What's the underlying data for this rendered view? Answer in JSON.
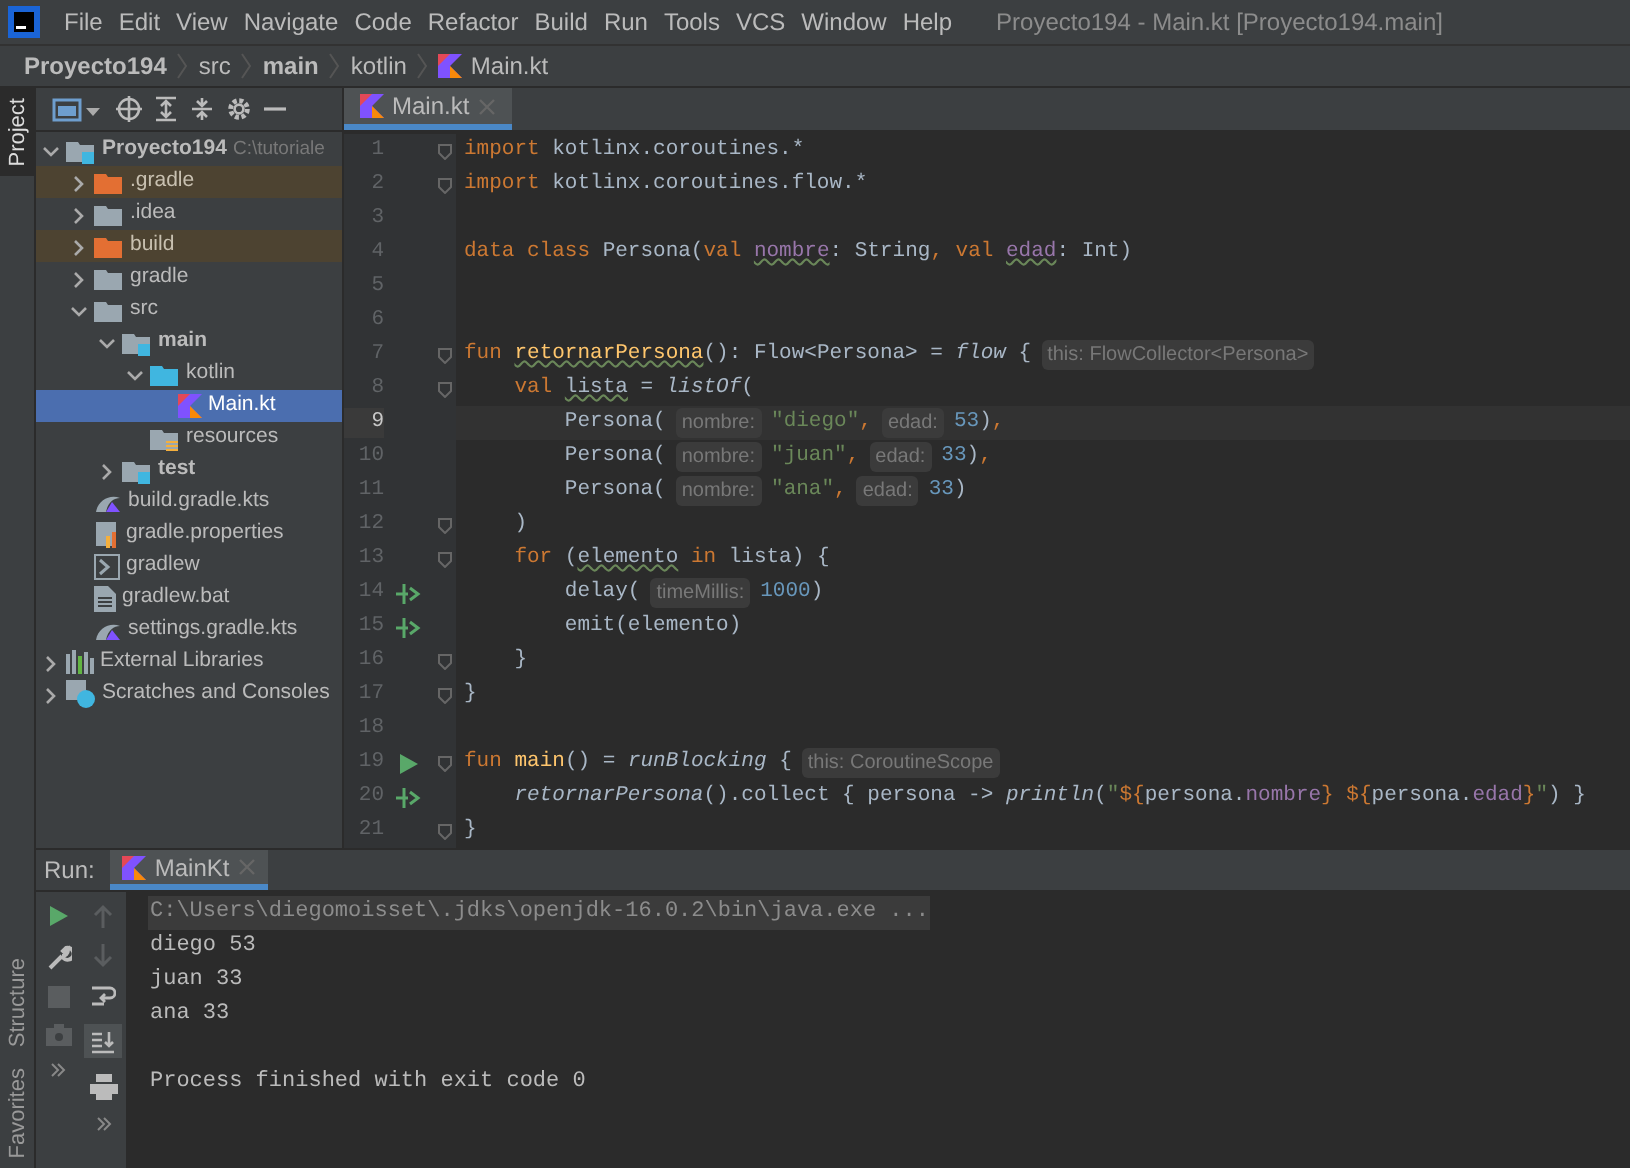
{
  "menu_bar": {
    "items": [
      "File",
      "Edit",
      "View",
      "Navigate",
      "Code",
      "Refactor",
      "Build",
      "Run",
      "Tools",
      "VCS",
      "Window",
      "Help"
    ],
    "title": "Proyecto194 - Main.kt [Proyecto194.main]"
  },
  "breadcrumbs": [
    {
      "label": "Proyecto194",
      "kind": "project"
    },
    {
      "label": "src",
      "kind": "dir"
    },
    {
      "label": "main",
      "kind": "module"
    },
    {
      "label": "kotlin",
      "kind": "dir"
    },
    {
      "label": "Main.kt",
      "kind": "file"
    }
  ],
  "left_strip": {
    "top": [
      {
        "label": "Project",
        "selected": true
      }
    ],
    "bottom": [
      {
        "label": "Structure",
        "selected": false
      },
      {
        "label": "Favorites",
        "selected": false
      }
    ]
  },
  "editor_tabs": [
    {
      "label": "Main.kt",
      "selected": true
    }
  ],
  "project_tree": [
    {
      "label": "Proyecto194",
      "note": "C:\\tutoriale",
      "kind": "project",
      "expanded": true,
      "selected": false,
      "excluded": false,
      "children": [
        {
          "label": ".gradle",
          "kind": "excluded-folder",
          "expanded": false,
          "selected": false,
          "excluded": true
        },
        {
          "label": ".idea",
          "kind": "folder",
          "expanded": false,
          "selected": false,
          "excluded": false
        },
        {
          "label": "build",
          "kind": "excluded-folder",
          "expanded": false,
          "selected": false,
          "excluded": true
        },
        {
          "label": "gradle",
          "kind": "folder",
          "expanded": false,
          "selected": false,
          "excluded": false
        },
        {
          "label": "src",
          "kind": "folder",
          "expanded": true,
          "selected": false,
          "excluded": false,
          "children": [
            {
              "label": "main",
              "kind": "module",
              "expanded": true,
              "selected": false,
              "excluded": false,
              "children": [
                {
                  "label": "kotlin",
                  "kind": "source-folder",
                  "expanded": true,
                  "selected": false,
                  "excluded": false,
                  "children": [
                    {
                      "label": "Main.kt",
                      "kind": "kotlin-file",
                      "selected": true,
                      "excluded": false
                    }
                  ]
                },
                {
                  "label": "resources",
                  "kind": "resources-folder",
                  "selected": false,
                  "excluded": false
                }
              ]
            },
            {
              "label": "test",
              "kind": "module",
              "expanded": false,
              "selected": false,
              "excluded": false
            }
          ]
        },
        {
          "label": "build.gradle.kts",
          "kind": "gradle-file",
          "selected": false,
          "excluded": false
        },
        {
          "label": "gradle.properties",
          "kind": "properties-file",
          "selected": false,
          "excluded": false
        },
        {
          "label": "gradlew",
          "kind": "script-file",
          "selected": false,
          "excluded": false
        },
        {
          "label": "gradlew.bat",
          "kind": "text-file",
          "selected": false,
          "excluded": false
        },
        {
          "label": "settings.gradle.kts",
          "kind": "gradle-file",
          "selected": false,
          "excluded": false
        }
      ]
    },
    {
      "label": "External Libraries",
      "kind": "libraries",
      "expanded": false,
      "selected": false,
      "excluded": false
    },
    {
      "label": "Scratches and Consoles",
      "kind": "scratches",
      "expanded": false,
      "selected": false,
      "excluded": false
    }
  ],
  "code_lines": [
    {
      "number": "1",
      "fold": true,
      "runnable": false,
      "suspends": false,
      "current": false,
      "tokens": [
        {
          "t": "import",
          "kind": "keyword"
        },
        {
          "t": " kotlinx.coroutines.*",
          "kind": "plain"
        }
      ]
    },
    {
      "number": "2",
      "fold": true,
      "runnable": false,
      "suspends": false,
      "current": false,
      "tokens": [
        {
          "t": "import",
          "kind": "keyword"
        },
        {
          "t": " kotlinx.coroutines.flow.*",
          "kind": "plain"
        }
      ]
    },
    {
      "number": "3",
      "fold": false,
      "runnable": false,
      "suspends": false,
      "current": false
    },
    {
      "number": "4",
      "fold": false,
      "runnable": false,
      "suspends": false,
      "current": false,
      "tokens": [
        {
          "t": "data class ",
          "kind": "keyword"
        },
        {
          "t": "Persona(",
          "kind": "plain"
        },
        {
          "t": "val ",
          "kind": "keyword"
        },
        {
          "t": "nombre",
          "kind": "property_warn"
        },
        {
          "t": ": String",
          "kind": "plain"
        },
        {
          "t": ", val ",
          "kind": "keyword"
        },
        {
          "t": "edad",
          "kind": "property_warn"
        },
        {
          "t": ": Int)",
          "kind": "plain"
        }
      ]
    },
    {
      "number": "5",
      "fold": false,
      "runnable": false,
      "suspends": false,
      "current": false
    },
    {
      "number": "6",
      "fold": false,
      "runnable": false,
      "suspends": false,
      "current": false
    },
    {
      "number": "7",
      "fold": true,
      "runnable": false,
      "suspends": false,
      "current": false,
      "tokens": [
        {
          "t": "fun ",
          "kind": "keyword"
        },
        {
          "t": "retornarPersona",
          "kind": "function_warn"
        },
        {
          "t": "(): Flow<Persona> = ",
          "kind": "plain"
        },
        {
          "t": "flow",
          "kind": "italic"
        },
        {
          "t": " {",
          "kind": "plain"
        },
        {
          "t": "this: FlowCollector<Persona>",
          "kind": "hint"
        }
      ]
    },
    {
      "number": "8",
      "fold": true,
      "runnable": false,
      "suspends": false,
      "current": false,
      "tokens": [
        {
          "t": "    val ",
          "kind": "keyword"
        },
        {
          "t": "lista",
          "kind": "plain_warn"
        },
        {
          "t": " = ",
          "kind": "plain"
        },
        {
          "t": "listOf",
          "kind": "italic"
        },
        {
          "t": "(",
          "kind": "plain"
        }
      ]
    },
    {
      "number": "9",
      "fold": false,
      "runnable": false,
      "suspends": false,
      "current": true,
      "tokens": [
        {
          "t": "        Persona(",
          "kind": "plain"
        },
        {
          "t": "nombre:",
          "kind": "hint"
        },
        {
          "t": "\"diego\"",
          "kind": "string"
        },
        {
          "t": ",",
          "kind": "keyword"
        },
        {
          "t": "edad:",
          "kind": "hint"
        },
        {
          "t": "53",
          "kind": "number"
        },
        {
          "t": ")",
          "kind": "plain"
        },
        {
          "t": ",",
          "kind": "keyword"
        }
      ]
    },
    {
      "number": "10",
      "fold": false,
      "runnable": false,
      "suspends": false,
      "current": false,
      "tokens": [
        {
          "t": "        Persona(",
          "kind": "plain"
        },
        {
          "t": "nombre:",
          "kind": "hint"
        },
        {
          "t": "\"juan\"",
          "kind": "string"
        },
        {
          "t": ",",
          "kind": "keyword"
        },
        {
          "t": "edad:",
          "kind": "hint"
        },
        {
          "t": "33",
          "kind": "number"
        },
        {
          "t": ")",
          "kind": "plain"
        },
        {
          "t": ",",
          "kind": "keyword"
        }
      ]
    },
    {
      "number": "11",
      "fold": false,
      "runnable": false,
      "suspends": false,
      "current": false,
      "tokens": [
        {
          "t": "        Persona(",
          "kind": "plain"
        },
        {
          "t": "nombre:",
          "kind": "hint"
        },
        {
          "t": "\"ana\"",
          "kind": "string"
        },
        {
          "t": ",",
          "kind": "keyword"
        },
        {
          "t": "edad:",
          "kind": "hint"
        },
        {
          "t": "33",
          "kind": "number"
        },
        {
          "t": ")",
          "kind": "plain"
        }
      ]
    },
    {
      "number": "12",
      "fold": true,
      "runnable": false,
      "suspends": false,
      "current": false,
      "tokens": [
        {
          "t": "    )",
          "kind": "plain"
        }
      ]
    },
    {
      "number": "13",
      "fold": true,
      "runnable": false,
      "suspends": false,
      "current": false,
      "tokens": [
        {
          "t": "    for",
          "kind": "keyword"
        },
        {
          "t": " (",
          "kind": "plain"
        },
        {
          "t": "elemento",
          "kind": "plain_warn"
        },
        {
          "t": " in",
          "kind": "keyword"
        },
        {
          "t": " lista) {",
          "kind": "plain"
        }
      ]
    },
    {
      "number": "14",
      "fold": false,
      "runnable": false,
      "suspends": true,
      "current": false,
      "tokens": [
        {
          "t": "        delay(",
          "kind": "plain"
        },
        {
          "t": "timeMillis:",
          "kind": "hint"
        },
        {
          "t": "1000",
          "kind": "number"
        },
        {
          "t": ")",
          "kind": "plain"
        }
      ]
    },
    {
      "number": "15",
      "fold": false,
      "runnable": false,
      "suspends": true,
      "current": false,
      "tokens": [
        {
          "t": "        emit(elemento)",
          "kind": "plain"
        }
      ]
    },
    {
      "number": "16",
      "fold": true,
      "runnable": false,
      "suspends": false,
      "current": false,
      "tokens": [
        {
          "t": "    }",
          "kind": "plain"
        }
      ]
    },
    {
      "number": "17",
      "fold": true,
      "runnable": false,
      "suspends": false,
      "current": false,
      "tokens": [
        {
          "t": "}",
          "kind": "plain"
        }
      ]
    },
    {
      "number": "18",
      "fold": false,
      "runnable": false,
      "suspends": false,
      "current": false
    },
    {
      "number": "19",
      "fold": true,
      "runnable": true,
      "suspends": false,
      "current": false,
      "tokens": [
        {
          "t": "fun ",
          "kind": "keyword"
        },
        {
          "t": "main",
          "kind": "function"
        },
        {
          "t": "() = ",
          "kind": "plain"
        },
        {
          "t": "runBlocking",
          "kind": "italic"
        },
        {
          "t": " {",
          "kind": "plain"
        },
        {
          "t": "this: CoroutineScope",
          "kind": "hint"
        }
      ]
    },
    {
      "number": "20",
      "fold": false,
      "runnable": false,
      "suspends": true,
      "current": false,
      "tokens": [
        {
          "t": "    retornarPersona",
          "kind": "italic"
        },
        {
          "t": "().collect { persona -> ",
          "kind": "plain"
        },
        {
          "t": "println",
          "kind": "italic"
        },
        {
          "t": "(",
          "kind": "plain"
        },
        {
          "t": "\"",
          "kind": "string"
        },
        {
          "t": "${",
          "kind": "template"
        },
        {
          "t": "persona.",
          "kind": "plain"
        },
        {
          "t": "nombre",
          "kind": "property"
        },
        {
          "t": "} ${",
          "kind": "template"
        },
        {
          "t": "persona.",
          "kind": "plain"
        },
        {
          "t": "edad",
          "kind": "property"
        },
        {
          "t": "}",
          "kind": "template"
        },
        {
          "t": "\"",
          "kind": "string"
        },
        {
          "t": ") }",
          "kind": "plain"
        }
      ]
    },
    {
      "number": "21",
      "fold": true,
      "runnable": false,
      "suspends": false,
      "current": false,
      "tokens": [
        {
          "t": "}",
          "kind": "plain"
        }
      ]
    }
  ],
  "run_panel": {
    "label": "Run:",
    "tabs": [
      {
        "label": "MainKt",
        "selected": true
      }
    ],
    "console": [
      {
        "text": "C:\\Users\\diegomoisset\\.jdks\\openjdk-16.0.2\\bin\\java.exe ...",
        "kind": "command"
      },
      {
        "text": "diego 53",
        "kind": "output"
      },
      {
        "text": "juan 33",
        "kind": "output"
      },
      {
        "text": "ana 33",
        "kind": "output"
      },
      {
        "text": "Process finished with exit code 0",
        "kind": "exit"
      }
    ]
  }
}
